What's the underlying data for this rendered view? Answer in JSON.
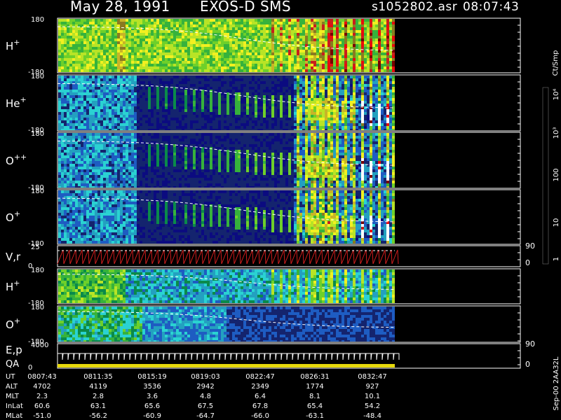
{
  "header": {
    "date": "May 28, 1991",
    "instrument": "EXOS-D SMS",
    "file": "s1052802.asr",
    "time": "08:07:43"
  },
  "colorbar": {
    "unit_label": "Ct/Smp",
    "ticks": [
      "1",
      "10",
      "100",
      "10³",
      "10⁴"
    ],
    "colors": [
      "#0b0b80",
      "#14246e",
      "#1e5cc2",
      "#23a0c0",
      "#2ad2d2",
      "#0a8a4a",
      "#36b23c",
      "#6ed02a",
      "#b8e426",
      "#f2f020",
      "#c8b428",
      "#8a7a20",
      "#c81e1e",
      "#e80c0c",
      "#7a0000",
      "#ffffff"
    ]
  },
  "footer_tag": "Sep-00  2AA32L",
  "chart_data": [
    {
      "type": "heatmap",
      "name": "H+",
      "ylim": [
        -180,
        180
      ],
      "tick_labels": [
        "180",
        "-180"
      ],
      "style": "h"
    },
    {
      "type": "heatmap",
      "name": "He+",
      "ylim": [
        -180,
        180
      ],
      "tick_labels": [
        "180",
        "-180"
      ],
      "style": "he"
    },
    {
      "type": "heatmap",
      "name": "O++",
      "ylim": [
        -180,
        180
      ],
      "tick_labels": [
        "180",
        "-180"
      ],
      "style": "o2"
    },
    {
      "type": "heatmap",
      "name": "O+",
      "ylim": [
        -180,
        180
      ],
      "tick_labels": [
        "180",
        "-180"
      ],
      "style": "o"
    },
    {
      "type": "line",
      "name": "V,r",
      "ylim": [
        0,
        25
      ],
      "tick_labels": [
        "25",
        "0"
      ],
      "right_ticks": [
        "90",
        "0"
      ]
    },
    {
      "type": "heatmap",
      "name": "H+",
      "ylim": [
        -180,
        180
      ],
      "tick_labels": [
        "180",
        "-180"
      ],
      "style": "h2"
    },
    {
      "type": "heatmap",
      "name": "O+",
      "ylim": [
        -180,
        180
      ],
      "tick_labels": [
        "180",
        "-180"
      ],
      "style": "o3"
    },
    {
      "type": "line",
      "name": "E,p",
      "name2": "QA",
      "ylim": [
        0,
        4000
      ],
      "tick_labels": [
        "4000",
        "0"
      ],
      "right_ticks": [
        "90",
        "0"
      ]
    }
  ],
  "ephemeris": {
    "rows": [
      {
        "label": "UT",
        "values": [
          "0807:43",
          "0811:35",
          "0815:19",
          "0819:03",
          "0822:47",
          "0826:31",
          "0832:47"
        ]
      },
      {
        "label": "ALT",
        "values": [
          "4702",
          "4119",
          "3536",
          "2942",
          "2349",
          "1774",
          "927"
        ]
      },
      {
        "label": "MLT",
        "values": [
          "2.3",
          "2.8",
          "3.6",
          "4.8",
          "6.4",
          "8.1",
          "10.1"
        ]
      },
      {
        "label": "InLat",
        "values": [
          "60.6",
          "63.1",
          "65.6",
          "67.5",
          "67.8",
          "65.4",
          "54.2"
        ]
      },
      {
        "label": "MLat",
        "values": [
          "-51.0",
          "-56.2",
          "-60.9",
          "-64.7",
          "-66.0",
          "-63.1",
          "-48.4"
        ]
      }
    ]
  }
}
